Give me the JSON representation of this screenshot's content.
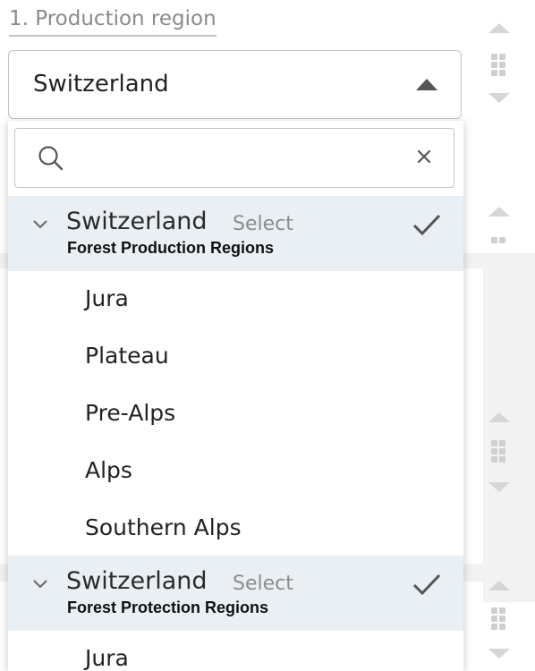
{
  "field": {
    "label": "1. Production region",
    "value": "Switzerland"
  },
  "search": {
    "placeholder": "",
    "value": ""
  },
  "groups": [
    {
      "title": "Switzerland",
      "select_label": "Select",
      "subtitle": "Forest Production Regions",
      "items": [
        "Jura",
        "Plateau",
        "Pre-Alps",
        "Alps",
        "Southern Alps"
      ]
    },
    {
      "title": "Switzerland",
      "select_label": "Select",
      "subtitle": "Forest Protection Regions",
      "items": [
        "Jura"
      ]
    }
  ],
  "icons": {
    "search": "search-icon",
    "clear": "close-icon",
    "expand": "chevron-down-icon",
    "selected": "check-icon",
    "caret": "caret-up-icon",
    "reorder": "drag-handle-icon"
  },
  "colors": {
    "group_header_bg": "#eaeff3",
    "border": "#c3c3c3",
    "muted_text": "#8a8a8a"
  }
}
